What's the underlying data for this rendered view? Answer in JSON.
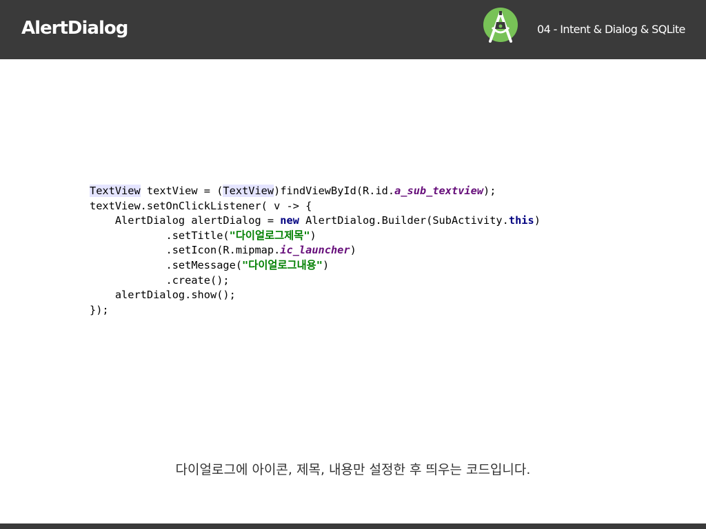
{
  "header": {
    "title": "AlertDialog",
    "subtitle": "04 - Intent & Dialog & SQLite",
    "logo_icon": "android-studio-icon",
    "background_color": "#3a3a3a"
  },
  "code": {
    "l1a": "TextView",
    "l1b": " textView = (",
    "l1c": "TextView",
    "l1d": ")findViewById(R.id.",
    "l1e": "a_sub_textview",
    "l1f": ");",
    "l2": "textView.setOnClickListener( v -> {",
    "l3a": "    AlertDialog alertDialog = ",
    "l3b": "new",
    "l3c": " AlertDialog.Builder(SubActivity.",
    "l3d": "this",
    "l3e": ")",
    "l4a": "            .setTitle(",
    "l4b": "\"다이얼로그제목\"",
    "l4c": ")",
    "l5a": "            .setIcon(R.mipmap.",
    "l5b": "ic_launcher",
    "l5c": ")",
    "l6a": "            .setMessage(",
    "l6b": "\"다이얼로그내용\"",
    "l6c": ")",
    "l7": "            .create();",
    "l8": "    alertDialog.show();",
    "l9": "});"
  },
  "caption": "다이얼로그에 아이콘, 제목, 내용만 설정한 후 띄우는 코드입니다."
}
